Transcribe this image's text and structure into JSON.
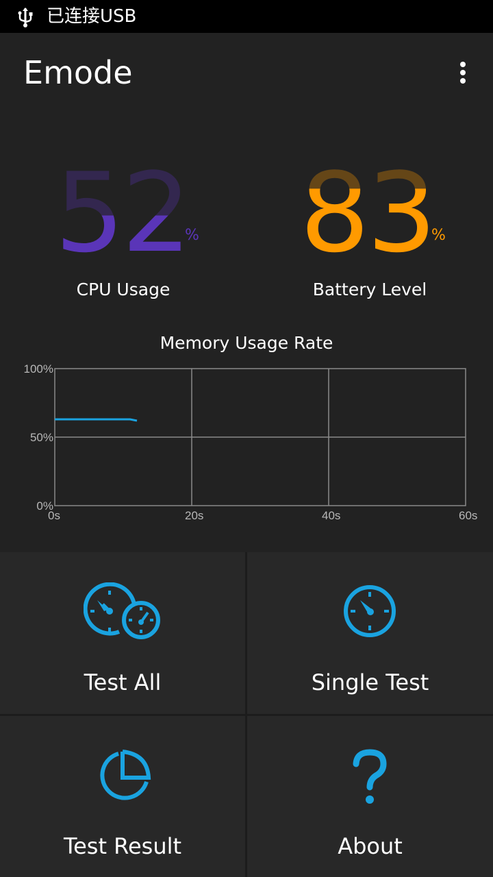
{
  "status_bar": {
    "text": "已连接USB"
  },
  "app_bar": {
    "title": "Emode"
  },
  "gauges": {
    "cpu": {
      "value": "52",
      "unit": "%",
      "label": "CPU Usage",
      "fill": 0.52,
      "color": "#5a35b8"
    },
    "battery": {
      "value": "83",
      "unit": "%",
      "label": "Battery Level",
      "fill": 0.83,
      "color": "#ff9a00"
    }
  },
  "chart_data": {
    "type": "line",
    "title": "Memory Usage Rate",
    "xlabel": "",
    "ylabel": "",
    "x_ticks": [
      "0s",
      "20s",
      "40s",
      "60s"
    ],
    "y_ticks": [
      "0%",
      "50%",
      "100%"
    ],
    "xlim": [
      0,
      60
    ],
    "ylim": [
      0,
      100
    ],
    "grid": true,
    "series": [
      {
        "x": [
          0,
          1,
          2,
          3,
          4,
          5,
          6,
          7,
          8,
          9,
          10,
          11,
          12
        ],
        "y": [
          63,
          63,
          63,
          63,
          63,
          63,
          63,
          63,
          63,
          63,
          63,
          63,
          62
        ],
        "color": "#1aa3e0"
      }
    ]
  },
  "menu": {
    "test_all": "Test All",
    "single_test": "Single Test",
    "test_result": "Test Result",
    "about": "About"
  },
  "colors": {
    "accent": "#1aa3e0",
    "background": "#222222",
    "tile": "#282828"
  }
}
